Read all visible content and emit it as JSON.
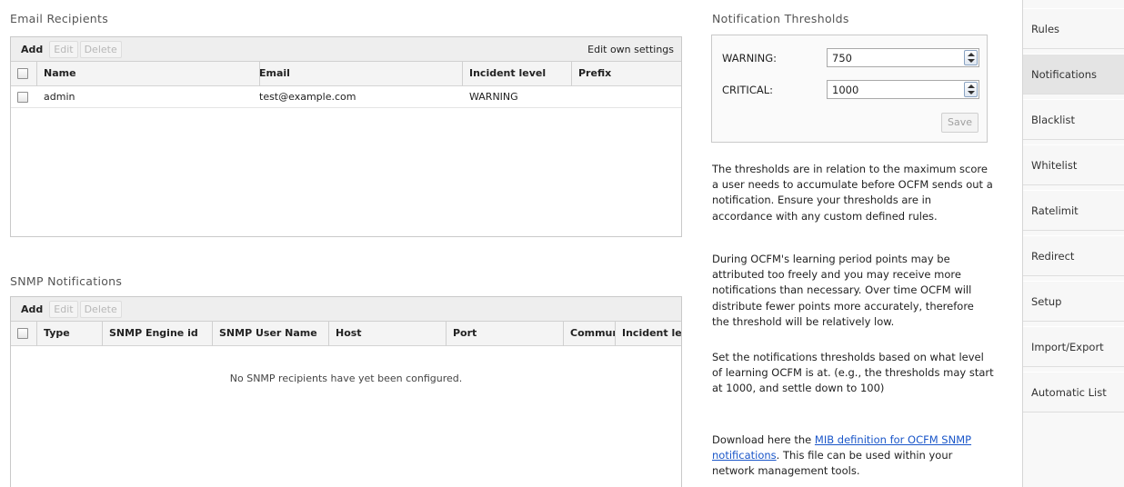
{
  "email_section": {
    "title": "Email Recipients",
    "toolbar": {
      "add": "Add",
      "edit": "Edit",
      "delete": "Delete",
      "edit_own": "Edit own settings"
    },
    "columns": [
      "Name",
      "Email",
      "Incident level",
      "Prefix"
    ],
    "rows": [
      {
        "name": "admin",
        "email": "test@example.com",
        "incident_level": "WARNING",
        "prefix": ""
      }
    ]
  },
  "snmp_section": {
    "title": "SNMP Notifications",
    "toolbar": {
      "add": "Add",
      "edit": "Edit",
      "delete": "Delete"
    },
    "columns": [
      "Type",
      "SNMP Engine id",
      "SNMP User Name",
      "Host",
      "Port",
      "Communit",
      "Incident le"
    ],
    "empty_message": "No SNMP recipients have yet been configured."
  },
  "thresholds": {
    "title": "Notification Thresholds",
    "warning_label": "WARNING:",
    "warning_value": "750",
    "critical_label": "CRITICAL:",
    "critical_value": "1000",
    "save": "Save"
  },
  "info": {
    "p1": "The thresholds are in relation to the maximum score a user needs to accumulate before OCFM sends out a notification. Ensure your thresholds are in accordance with any custom defined rules.",
    "p2": "During OCFM's learning period points may be attributed too freely and you may receive more notifications than necessary. Over time OCFM will distribute fewer points more accurately, therefore the threshold will be relatively low.",
    "p3": "Set the notifications thresholds based on what level of learning OCFM is at. (e.g., the thresholds may start at 1000, and settle down to 100)",
    "p4_before": "Download here the ",
    "p4_link": "MIB definition for OCFM SNMP notifications",
    "p4_after": ". This file can be used within your network management tools."
  },
  "sidebar": {
    "items": [
      "Rules",
      "Notifications",
      "Blacklist",
      "Whitelist",
      "Ratelimit",
      "Redirect",
      "Setup",
      "Import/Export",
      "Automatic List"
    ],
    "active_index": 1
  }
}
